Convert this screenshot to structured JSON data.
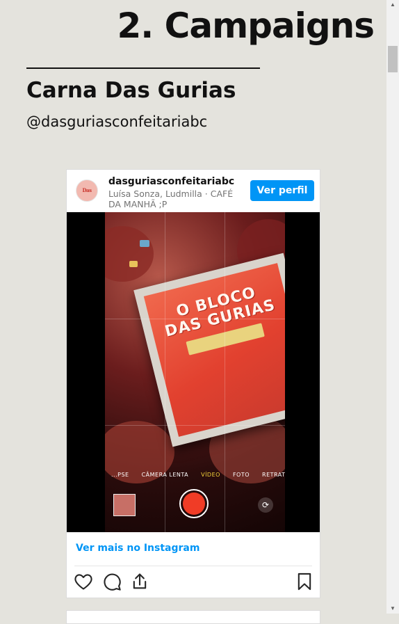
{
  "section": {
    "heading": "2. Campaigns"
  },
  "campaign": {
    "title": "Carna Das Gurias",
    "handle": "@dasguriasconfeitariabc"
  },
  "embed": {
    "username": "dasguriasconfeitariabc",
    "subtitle": "Luísa Sonza, Ludmilla · CAFÉ DA MANHÃ ;P",
    "follow_label": "Ver perfil",
    "avatar_text": "Das Gurias",
    "media": {
      "poster_title_line1": "O BLOCO",
      "poster_title_line2": "DAS GURIAS",
      "camera_modes": [
        "...PSE",
        "CÂMERA LENTA",
        "VÍDEO",
        "FOTO",
        "RETRATO"
      ],
      "active_mode_index": 2
    },
    "view_more_label": "Ver mais no Instagram",
    "icons": [
      "heart-icon",
      "comment-icon",
      "share-icon",
      "bookmark-icon"
    ]
  },
  "colors": {
    "background": "#e4e3dd",
    "instagram_blue": "#0095f6",
    "shutter_red": "#f03c26"
  }
}
